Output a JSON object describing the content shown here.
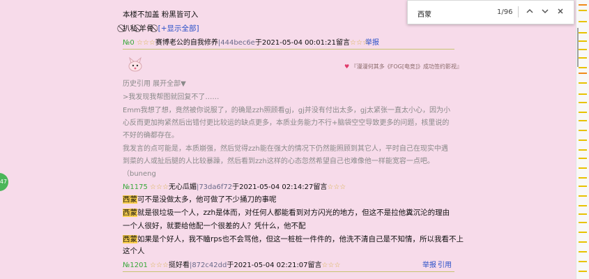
{
  "find": {
    "query": "西蒙",
    "count": "1/96",
    "prev_icon": "chevron-up-icon",
    "next_icon": "chevron-down-icon",
    "close_icon": "close-icon"
  },
  "badge": "47",
  "post0": {
    "text1": "本楼不加盖 粉黑皆可入",
    "tag1": "⃠扒私",
    "tag2": "⃠羊骨",
    "tag3": "⃠",
    "expand_all": "[+显示全部]",
    "floor": "№0",
    "stars_left": "☆☆☆",
    "nick": "赛博老公的自我修养",
    "hash": "|444bec6e",
    "time": "于2021-05-04 00:01:21留言",
    "stars_right": "☆☆☆",
    "report": "举报"
  },
  "post1175": {
    "sig_heart": "♥",
    "signature": "『漫漫何其多《FOG[电竞]》成功签约影视』",
    "history": "历史引用 展开全部▼",
    "q1": ">我发现我帮图就回复不了……",
    "q2": "Emm我想了想，竟然被你说服了，的确是zzh照顾看gj，gj并没有付出太多，gj太紧张一直太小心，因为小",
    "q3": "心反而更加拘紧然后出错付更比较运的缺点更多，本质业务能力不行+脑袋空空导致更多的问题，核里说的",
    "q4": "不好的确都存在。",
    "q5": "我发言的点可能是，本质崩强，然后觉得zzh能在强大的情况下仍然能照顾到其它人，平时自己在现实中遇",
    "q6": "到菜的人或扯后腿的人比较暴躁，然后看到zzh这样的心态忽然希望自己也难像他一样能宽容一点吧。",
    "q7": "（buneng",
    "floor": "№1175",
    "stars_left": "☆☆☆",
    "nick": "无心瓜媚",
    "hash": "|73da6f72",
    "time": "于2021-05-04 02:14:27留言",
    "stars_right": "☆☆☆",
    "hl": "西蒙",
    "b1": "可不是没做太多，他可做了不少捅刀的事呢",
    "b2": "就是很垃圾一个人，zzh是体而，对任何人都能看到对方闪光的地方，但这不是拉他糞沉沦的理由",
    "b3": "一个人很好，就要给他配一个很差的人？凭什么，他不配",
    "b4": "如果是个好人，我不瞌rps也不会骂他，但这一桩桩一件件的，他洗不清自己是不知情，所以我看不上",
    "b5": "这个人"
  },
  "post1201": {
    "floor": "№1201",
    "stars_left": "☆☆☆",
    "nick": "挺好看",
    "hash": "|872c42dd",
    "time": "于2021-05-04 02:21:07留言",
    "stars_right": "☆☆☆",
    "report": "举报",
    "quote": "引用"
  },
  "colors": {
    "page_bg": "#f7dbea",
    "meta_green": "#39a83a",
    "highlight": "#ffd24d",
    "link_blue": "#2a50c8"
  }
}
